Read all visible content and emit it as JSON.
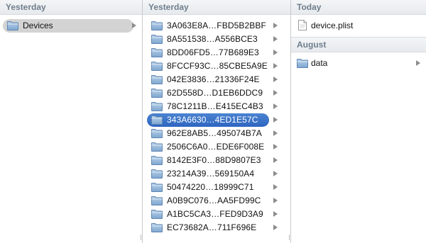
{
  "columns": {
    "col1": {
      "header": "Yesterday",
      "items": [
        {
          "label": "Devices",
          "has_children": true,
          "state": "selected-inactive"
        }
      ]
    },
    "col2": {
      "header": "Yesterday",
      "items": [
        {
          "label": "3A063E8A…FBD5B2BBF"
        },
        {
          "label": "8A551538…A556BCE3"
        },
        {
          "label": "8DD06FD5…77B689E3"
        },
        {
          "label": "8FCCF93C…85CBE5A9E"
        },
        {
          "label": "042E3836…21336F24E"
        },
        {
          "label": "62D558D…D1EB6DDC9"
        },
        {
          "label": "78C1211B…E415EC4B3"
        },
        {
          "label": "343A6630…4ED1E57C",
          "selected": true
        },
        {
          "label": "962E8AB5…495074B7A"
        },
        {
          "label": "2506C6A0…EDE6F008E"
        },
        {
          "label": "8142E3F0…88D9807E3"
        },
        {
          "label": "23214A39…569150A4"
        },
        {
          "label": "50474220…18999C71"
        },
        {
          "label": "A0B9C076…AA5FD99C"
        },
        {
          "label": "A1BC5CA3…FED9D3A9"
        },
        {
          "label": "EC73682A…711F696E"
        }
      ]
    },
    "col3": {
      "sections": [
        {
          "header": "Today",
          "items": [
            {
              "label": "device.plist",
              "type": "file"
            }
          ]
        },
        {
          "header": "August",
          "items": [
            {
              "label": "data",
              "type": "folder",
              "has_children": true
            }
          ]
        }
      ]
    }
  },
  "grip_glyph": "||",
  "colors": {
    "selection": "#3a72c8",
    "inactive_selection": "#d3d3d3",
    "header_text": "#6f7e8d",
    "folder": "#8fb2d6"
  }
}
